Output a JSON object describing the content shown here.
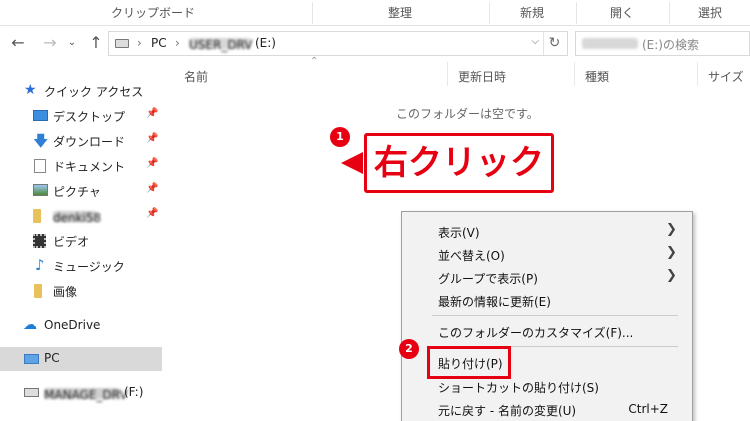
{
  "ribbon": {
    "groups": [
      "クリップボード",
      "整理",
      "新規",
      "開く",
      "選択"
    ]
  },
  "address": {
    "crumbs": [
      "PC",
      "USER_DRV",
      "(E:)"
    ],
    "search_placeholder": "(E:)の検索"
  },
  "sidebar": {
    "quick_access": "クイック アクセス",
    "items": [
      "デスクトップ",
      "ダウンロード",
      "ドキュメント",
      "ピクチャ",
      "denki58",
      "ビデオ",
      "ミュージック",
      "画像"
    ],
    "onedrive": "OneDrive",
    "pc": "PC",
    "drive": "MANAGE_DRV",
    "drive_letter": "(F:)"
  },
  "columns": [
    "名前",
    "更新日時",
    "種類",
    "サイズ"
  ],
  "empty_message": "このフォルダーは空です。",
  "annotations": {
    "step1": "1",
    "step2": "2",
    "callout": "右クリック",
    "accent_color": "#e60012"
  },
  "context_menu": {
    "items": [
      {
        "label": "表示(V)",
        "submenu": true
      },
      {
        "label": "並べ替え(O)",
        "submenu": true
      },
      {
        "label": "グループで表示(P)",
        "submenu": true
      },
      {
        "label": "最新の情報に更新(E)"
      },
      {
        "label": "このフォルダーのカスタマイズ(F)..."
      },
      {
        "label": "貼り付け(P)"
      },
      {
        "label": "ショートカットの貼り付け(S)"
      },
      {
        "label": "元に戻す - 名前の変更(U)",
        "shortcut": "Ctrl+Z"
      }
    ]
  }
}
